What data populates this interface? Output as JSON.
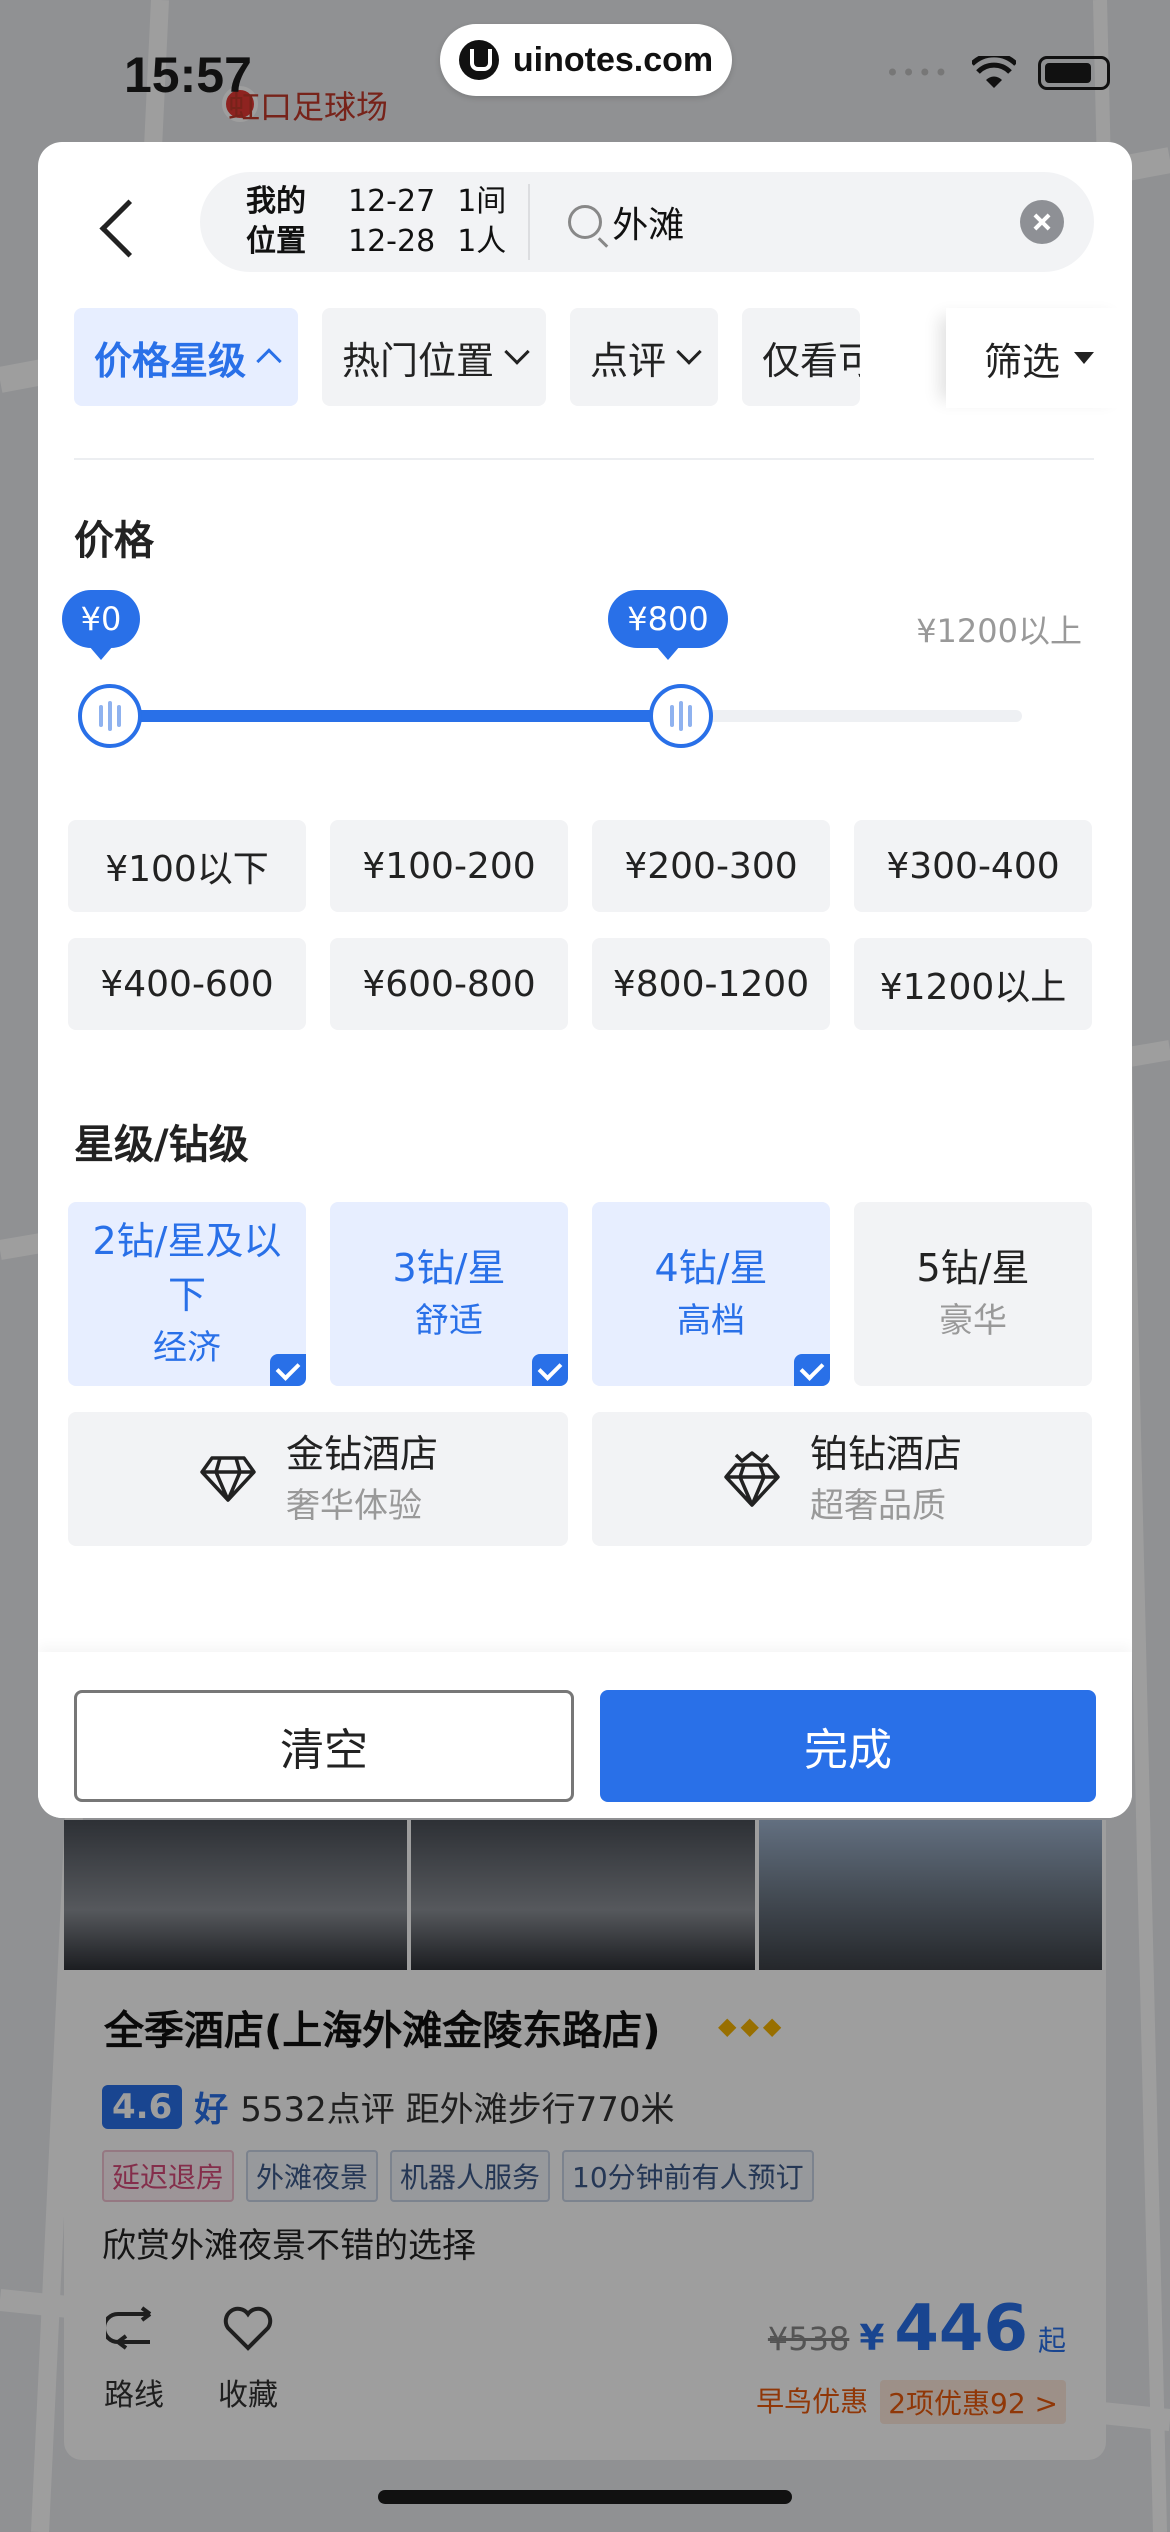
{
  "status_bar": {
    "time": "15:57"
  },
  "watermark": {
    "text": "uinotes.com"
  },
  "map": {
    "poi_label": "虹口足球场"
  },
  "search": {
    "location": [
      "我的",
      "位置"
    ],
    "dates": [
      "12-27",
      "12-28"
    ],
    "rooms": [
      "1间",
      "1人"
    ],
    "query": "外滩"
  },
  "filter_tabs": [
    {
      "label": "价格星级",
      "active": true
    },
    {
      "label": "热门位置",
      "active": false
    },
    {
      "label": "点评",
      "active": false
    },
    {
      "label": "仅看可",
      "active": false
    }
  ],
  "filter_button": {
    "label": "筛选"
  },
  "price": {
    "title": "价格",
    "min_label": "¥0",
    "max_label": "¥800",
    "cap_label": "¥1200以上",
    "range_min_fraction": 0.0,
    "range_max_fraction": 0.63,
    "presets": [
      "¥100以下",
      "¥100-200",
      "¥200-300",
      "¥300-400",
      "¥400-600",
      "¥600-800",
      "¥800-1200",
      "¥1200以上"
    ]
  },
  "star": {
    "title": "星级/钻级",
    "options": [
      {
        "main": "2钻/星及以下",
        "sub": "经济",
        "selected": true
      },
      {
        "main": "3钻/星",
        "sub": "舒适",
        "selected": true
      },
      {
        "main": "4钻/星",
        "sub": "高档",
        "selected": true
      },
      {
        "main": "5钻/星",
        "sub": "豪华",
        "selected": false
      }
    ],
    "diamond_options": [
      {
        "main": "金钻酒店",
        "sub": "奢华体验"
      },
      {
        "main": "铂钻酒店",
        "sub": "超奢品质"
      }
    ]
  },
  "footer": {
    "clear": "清空",
    "done": "完成"
  },
  "hotel_card": {
    "name": "全季酒店(上海外滩金陵东路店)",
    "score": "4.6",
    "score_word": "好",
    "reviews": "5532点评 距外滩步行770米",
    "tags": [
      "延迟退房",
      "外滩夜景",
      "机器人服务",
      "10分钟前有人预订"
    ],
    "desc": "欣赏外滩夜景不错的选择",
    "actions": [
      "路线",
      "收藏"
    ],
    "price_old": "¥538",
    "price_currency": "¥",
    "price_new": "446",
    "price_suffix": "起",
    "promo_1": "早鸟优惠",
    "promo_2": "2项优惠92 >"
  },
  "colors": {
    "accent": "#2970e8"
  }
}
